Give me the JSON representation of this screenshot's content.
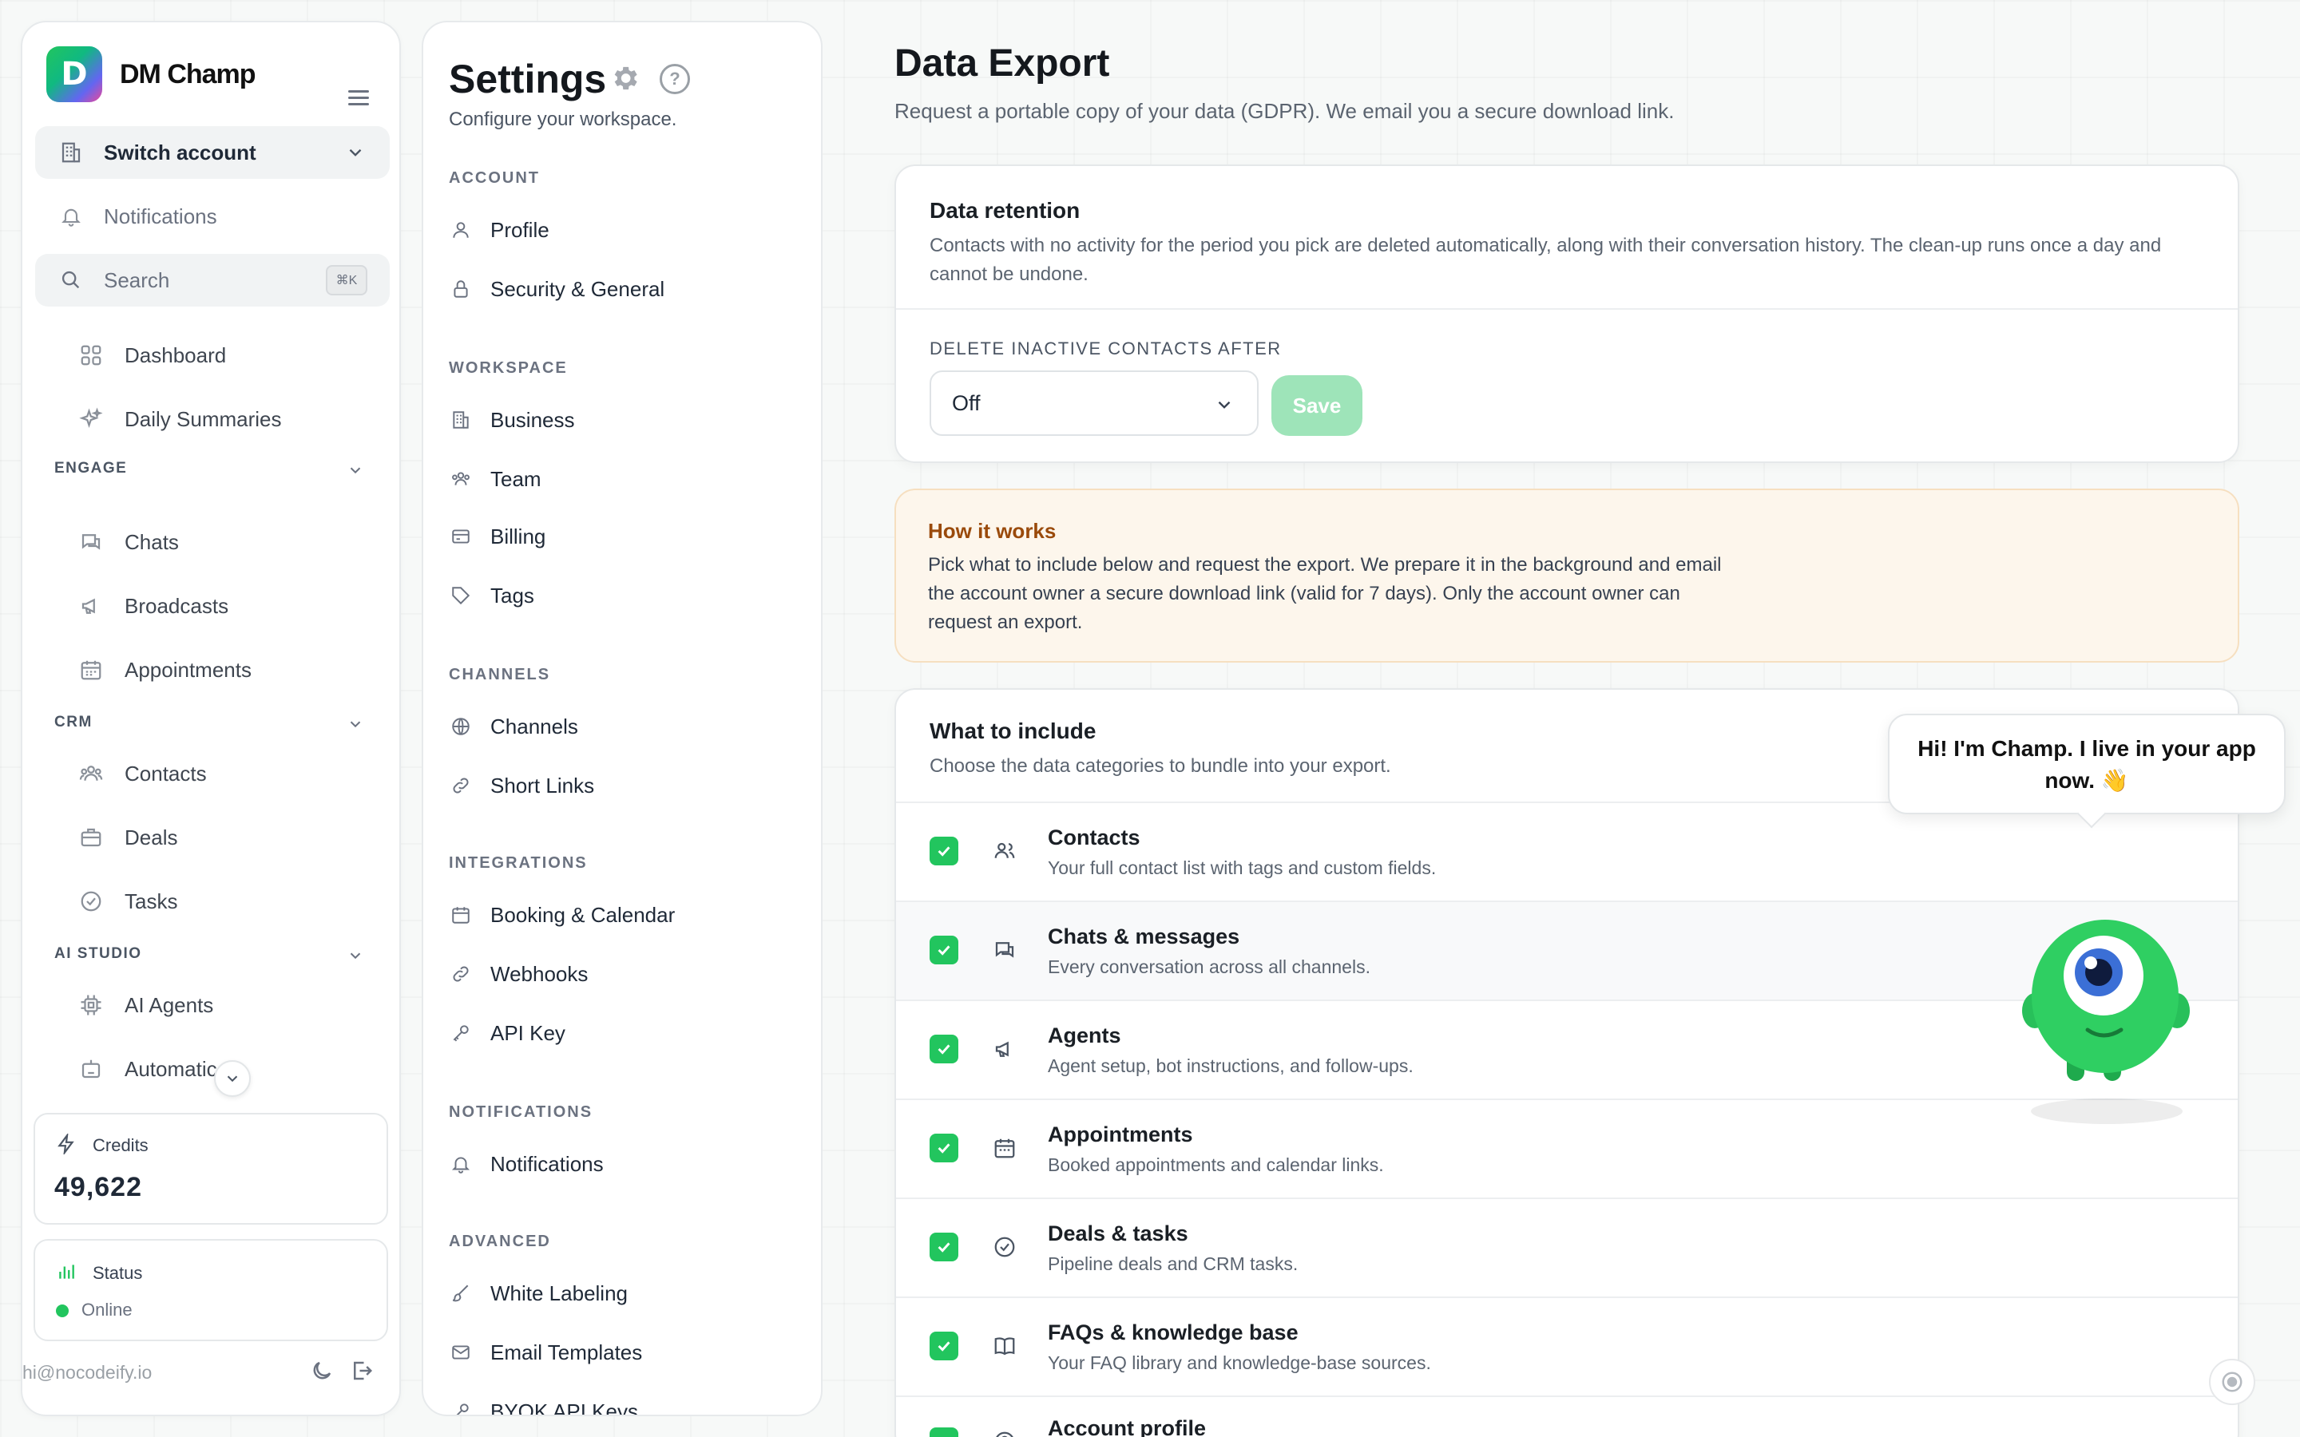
{
  "brand": {
    "name": "DM Champ",
    "logo_letter": "D"
  },
  "sidebar": {
    "switch_account": "Switch account",
    "notifications": "Notifications",
    "search_placeholder": "Search",
    "search_shortcut": "⌘K",
    "top_items": [
      {
        "label": "Dashboard",
        "icon": "grid-icon"
      },
      {
        "label": "Daily Summaries",
        "icon": "sparkles-icon"
      }
    ],
    "sections": [
      {
        "title": "ENGAGE",
        "items": [
          {
            "label": "Chats",
            "icon": "chat-icon"
          },
          {
            "label": "Broadcasts",
            "icon": "megaphone-icon"
          },
          {
            "label": "Appointments",
            "icon": "calendar-icon"
          }
        ]
      },
      {
        "title": "CRM",
        "items": [
          {
            "label": "Contacts",
            "icon": "users-icon"
          },
          {
            "label": "Deals",
            "icon": "briefcase-icon"
          },
          {
            "label": "Tasks",
            "icon": "check-circle-icon"
          }
        ]
      },
      {
        "title": "AI STUDIO",
        "items": [
          {
            "label": "AI Agents",
            "icon": "chip-icon"
          },
          {
            "label": "Automatic",
            "icon": "robot-icon"
          }
        ]
      }
    ],
    "credits_label": "Credits",
    "credits_value": "49,622",
    "status_label": "Status",
    "status_value": "Online",
    "user_email": "hi@nocodeify.io"
  },
  "settings": {
    "title": "Settings",
    "subtitle": "Configure your workspace.",
    "sections": [
      {
        "title": "ACCOUNT",
        "items": [
          "Profile",
          "Security & General"
        ]
      },
      {
        "title": "WORKSPACE",
        "items": [
          "Business",
          "Team",
          "Billing",
          "Tags"
        ]
      },
      {
        "title": "CHANNELS",
        "items": [
          "Channels",
          "Short Links"
        ]
      },
      {
        "title": "INTEGRATIONS",
        "items": [
          "Booking & Calendar",
          "Webhooks",
          "API Key"
        ]
      },
      {
        "title": "NOTIFICATIONS",
        "items": [
          "Notifications"
        ]
      },
      {
        "title": "ADVANCED",
        "items": [
          "White Labeling",
          "Email Templates",
          "BYOK API Keys"
        ]
      }
    ]
  },
  "main": {
    "title": "Data Export",
    "subtitle": "Request a portable copy of your data (GDPR). We email you a secure download link.",
    "retention": {
      "title": "Data retention",
      "description": "Contacts with no activity for the period you pick are deleted automatically, along with their conversation history. The clean-up runs once a day and cannot be undone.",
      "field_label": "DELETE INACTIVE CONTACTS AFTER",
      "selected": "Off",
      "save_label": "Save"
    },
    "how": {
      "title": "How it works",
      "text": "Pick what to include below and request the export. We prepare it in the background and email the account owner a secure download link (valid for 7 days). Only the account owner can request an export."
    },
    "include": {
      "title": "What to include",
      "subtitle": "Choose the data categories to bundle into your export.",
      "items": [
        {
          "title": "Contacts",
          "desc": "Your full contact list with tags and custom fields.",
          "checked": true,
          "icon": "users-icon"
        },
        {
          "title": "Chats & messages",
          "desc": "Every conversation across all channels.",
          "checked": true,
          "icon": "chat-icon"
        },
        {
          "title": "Agents",
          "desc": "Agent setup, bot instructions, and follow-ups.",
          "checked": true,
          "icon": "megaphone-icon"
        },
        {
          "title": "Appointments",
          "desc": "Booked appointments and calendar links.",
          "checked": true,
          "icon": "calendar-icon"
        },
        {
          "title": "Deals & tasks",
          "desc": "Pipeline deals and CRM tasks.",
          "checked": true,
          "icon": "check-circle-icon"
        },
        {
          "title": "FAQs & knowledge base",
          "desc": "Your FAQ library and knowledge-base sources.",
          "checked": true,
          "icon": "book-icon"
        },
        {
          "title": "Account profile",
          "desc": "",
          "checked": true,
          "icon": "user-icon"
        }
      ]
    }
  },
  "mascot": {
    "bubble": "Hi! I'm Champ. I live in your app now. 👋"
  },
  "colors": {
    "accent": "#22c55e",
    "warning_bg": "#fdf6ec",
    "warning_title": "#9a4a0b"
  }
}
